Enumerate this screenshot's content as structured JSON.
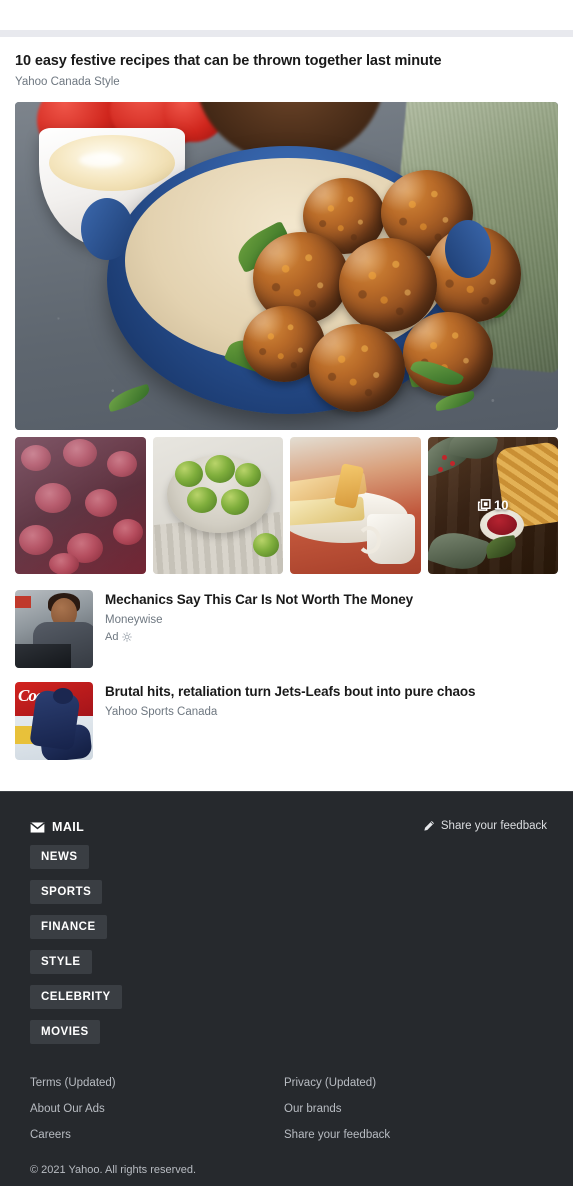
{
  "page": {
    "background": "#ffffff",
    "separator_color": "#e8e9ee"
  },
  "lede": {
    "title": "10 easy festive recipes that can be thrown together last minute",
    "source": "Yahoo Canada Style",
    "hero_alt": "Platter of festive meatballs in a blue baking dish",
    "photo_count_badge": "10"
  },
  "thumbnails": [
    {
      "name": "sangria-thumbnail",
      "alt": "Red sangria with citrus slices"
    },
    {
      "name": "brussels-sprouts-thumbnail",
      "alt": "Brussels sprouts in a stone bowl"
    },
    {
      "name": "breakfast-table-thumbnail",
      "alt": "Bread and mug on a red tablecloth"
    },
    {
      "name": "christmas-table-thumbnail",
      "alt": "Pastry and jam on a dark wooden table"
    }
  ],
  "stories": [
    {
      "title": "Mechanics Say This Car Is Not Worth The Money",
      "source": "Moneywise",
      "ad_label": "Ad",
      "is_ad": true,
      "thumb_alt": "Smiling mechanic working on a car engine"
    },
    {
      "title": "Brutal hits, retaliation turn Jets-Leafs bout into pure chaos",
      "source": "Yahoo Sports Canada",
      "is_ad": false,
      "thumb_alt": "Two hockey players scuffling on the ice"
    }
  ],
  "footer": {
    "background": "#26292d",
    "pill_background": "#3a3e43",
    "mail_label": "MAIL",
    "feedback_label": "Share your feedback",
    "nav": [
      {
        "label": "NEWS"
      },
      {
        "label": "SPORTS"
      },
      {
        "label": "FINANCE"
      },
      {
        "label": "STYLE"
      },
      {
        "label": "CELEBRITY"
      },
      {
        "label": "MOVIES"
      }
    ],
    "legal_left": [
      {
        "label": "Terms (Updated)"
      },
      {
        "label": "About Our Ads"
      },
      {
        "label": "Careers"
      }
    ],
    "legal_right": [
      {
        "label": "Privacy (Updated)"
      },
      {
        "label": "Our brands"
      },
      {
        "label": "Share your feedback"
      }
    ],
    "copyright": "© 2021 Yahoo. All rights reserved."
  }
}
